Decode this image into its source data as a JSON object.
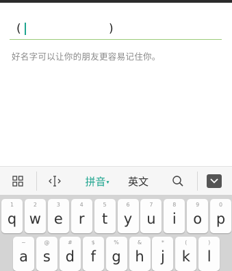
{
  "input": {
    "paren_open": "(",
    "paren_close": ")"
  },
  "hint": "好名字可以让你的朋友更容易记住你。",
  "toolbar": {
    "grid_icon": "grid-icon",
    "cursor_icon": "cursor-move-icon",
    "pinyin_label": "拼音",
    "pinyin_arrow": "▾",
    "english_label": "英文",
    "search_icon": "search-icon",
    "hide_icon": "keyboard-hide-icon",
    "accent_color": "#1fa58f"
  },
  "keyboard": {
    "row1": [
      {
        "hint": "1",
        "char": "q"
      },
      {
        "hint": "2",
        "char": "w"
      },
      {
        "hint": "3",
        "char": "e"
      },
      {
        "hint": "4",
        "char": "r"
      },
      {
        "hint": "5",
        "char": "t"
      },
      {
        "hint": "6",
        "char": "y"
      },
      {
        "hint": "7",
        "char": "u"
      },
      {
        "hint": "8",
        "char": "i"
      },
      {
        "hint": "9",
        "char": "o"
      },
      {
        "hint": "0",
        "char": "p"
      }
    ],
    "row2": [
      {
        "hint": "~",
        "char": "a"
      },
      {
        "hint": "@",
        "char": "s"
      },
      {
        "hint": "#",
        "char": "d"
      },
      {
        "hint": "$",
        "char": "f"
      },
      {
        "hint": "%",
        "char": "g"
      },
      {
        "hint": "&",
        "char": "h"
      },
      {
        "hint": "*",
        "char": "j"
      },
      {
        "hint": "(",
        "char": "k"
      },
      {
        "hint": ")",
        "char": "l"
      }
    ]
  }
}
